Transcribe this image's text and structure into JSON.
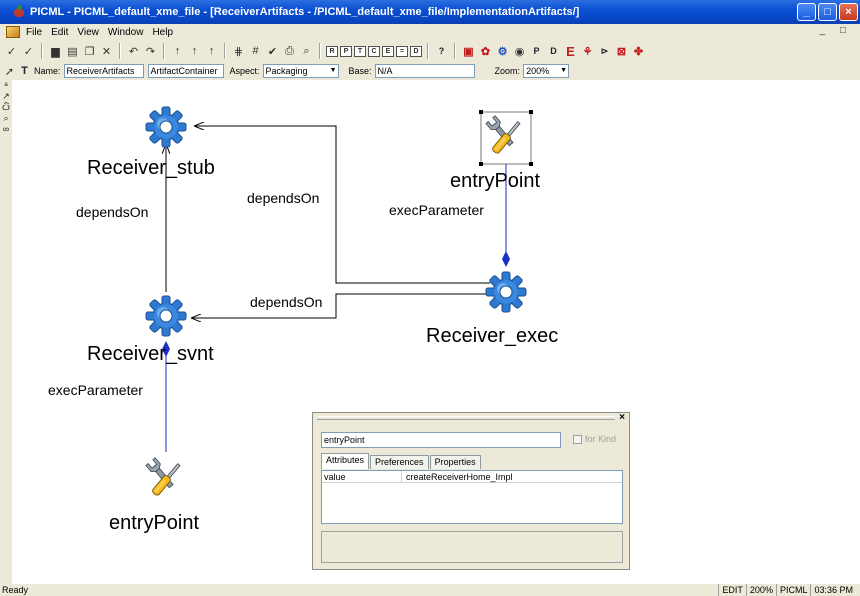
{
  "window": {
    "title": "PICML - PICML_default_xme_file - [ReceiverArtifacts - /PICML_default_xme_file/ImplementationArtifacts/]",
    "buttons": [
      "_",
      "□",
      "×"
    ]
  },
  "menubar": {
    "items": [
      "File",
      "Edit",
      "View",
      "Window",
      "Help"
    ],
    "mdi_controls": "_ □"
  },
  "toolbar": {
    "icons": [
      "check-icon",
      "check-icon",
      "save-icon",
      "print-icon",
      "copy-icon",
      "delete-icon",
      "undo-icon",
      "redo-icon",
      "up-icon",
      "up-icon",
      "up-icon",
      "grid-icon",
      "grid-icon",
      "check-icon",
      "print-icon",
      "find-icon",
      "box-icon",
      "box-icon",
      "box-icon",
      "box-icon",
      "box-icon",
      "box-icon",
      "box-icon",
      "help-icon",
      "model-icon",
      "model-icon",
      "model-icon",
      "model-icon",
      "model-icon",
      "model-icon",
      "model-icon",
      "model-icon",
      "model-icon",
      "model-icon"
    ],
    "box_letters": [
      "R",
      "P",
      "T",
      "C",
      "E",
      "=",
      "D"
    ],
    "help_label": "?",
    "letters": [
      "P",
      "D",
      "E"
    ]
  },
  "namebar": {
    "name_label": "Name:",
    "name_value": "ReceiverArtifacts",
    "kind_value": "ArtifactContainer",
    "aspect_label": "Aspect:",
    "aspect_value": "Packaging",
    "base_label": "Base:",
    "base_value": "N/A",
    "zoom_label": "Zoom:",
    "zoom_value": "200%"
  },
  "diagram": {
    "nodes": {
      "receiver_stub": "Receiver_stub",
      "receiver_svnt": "Receiver_svnt",
      "receiver_exec": "Receiver_exec",
      "entry_point_top": "entryPoint",
      "entry_point_bottom": "entryPoint"
    },
    "connections": {
      "svnt_to_stub": "dependsOn",
      "exec_to_stub": "dependsOn",
      "exec_to_svnt": "dependsOn",
      "exec_param_top": "execParameter",
      "exec_param_bottom": "execParameter"
    },
    "colors": {
      "gear": "#2f7ad1",
      "arrow": "#000000",
      "param_line": "#1c2fc8"
    }
  },
  "inspector": {
    "close": "×",
    "object_name": "entryPoint",
    "for_kind": "for Kind",
    "tabs": [
      "Attributes",
      "Preferences",
      "Properties"
    ],
    "attributes": [
      {
        "key": "value",
        "value": "createReceiverHome_Impl"
      }
    ]
  },
  "statusbar": {
    "status": "Ready",
    "cells": [
      "EDIT",
      "200%",
      "PICML",
      "03:36 PM"
    ]
  }
}
